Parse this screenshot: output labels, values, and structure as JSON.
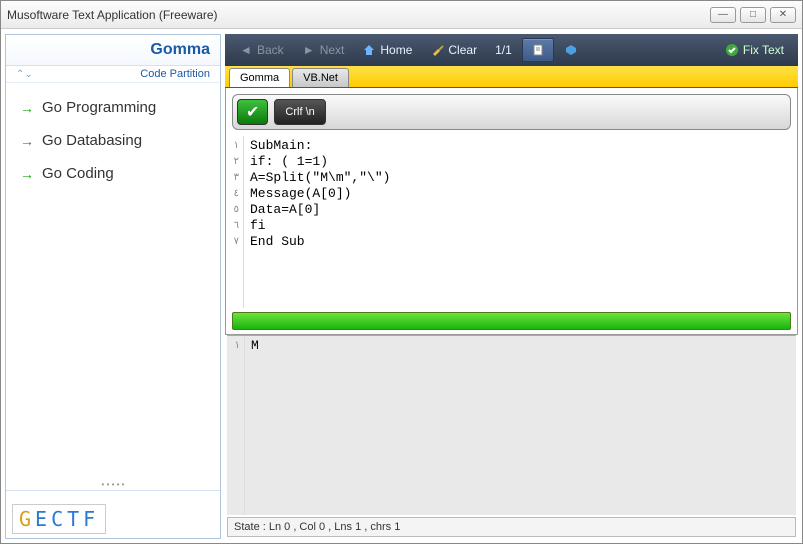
{
  "window": {
    "title": "Musoftware Text Application (Freeware)"
  },
  "sidebar": {
    "heading": "Gomma",
    "subheading": "Code Partition",
    "items": [
      {
        "label": "Go Programming"
      },
      {
        "label": "Go Databasing"
      },
      {
        "label": "Go Coding"
      }
    ],
    "logo": "GECTF"
  },
  "toolbar": {
    "back": "Back",
    "next": "Next",
    "home": "Home",
    "clear": "Clear",
    "counter": "1/1",
    "fix": "Fix Text"
  },
  "tabs": [
    {
      "label": "Gomma",
      "active": true
    },
    {
      "label": "VB.Net",
      "active": false
    }
  ],
  "editor": {
    "crlf_label": "Crlf \\n",
    "line_numbers": [
      "١",
      "٢",
      "٣",
      "٤",
      "٥",
      "٦",
      "٧"
    ],
    "code": "SubMain:\nif: ( 1=1)\nA=Split(\"M\\m\",\"\\\")\nMessage(A[0])\nData=A[0]\nfi\nEnd Sub"
  },
  "output": {
    "line_numbers": [
      "١"
    ],
    "text": "M"
  },
  "status": "State :  Ln 0 , Col 0 , Lns 1 , chrs 1"
}
